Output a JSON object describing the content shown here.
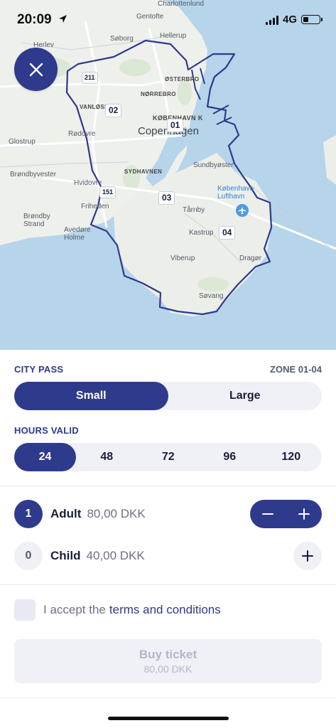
{
  "status_bar": {
    "time": "20:09",
    "network": "4G"
  },
  "map": {
    "zones": [
      "01",
      "02",
      "03",
      "04"
    ],
    "places": [
      "Charlottenlund",
      "Gentofte",
      "Herlev",
      "Søborg",
      "Hellerup",
      "ØSTERBRO",
      "NØRREBRO",
      "VANLØSE",
      "KØBENHAVN K",
      "Copenhagen",
      "Glostrup",
      "Rødovre",
      "Brøndbyvester",
      "SYDHAVNEN",
      "Hvidovre",
      "Sundbyøster",
      "København Lufthavn",
      "Friheden",
      "Tårnby",
      "Brøndby Strand",
      "Avedøre Holme",
      "Kastrup",
      "Dragør",
      "Viberup",
      "Søvang"
    ],
    "roads": [
      "211",
      "151"
    ]
  },
  "panel": {
    "pass_label": "CITY PASS",
    "zone_label": "ZONE 01-04",
    "size_options": [
      "Small",
      "Large"
    ],
    "selected_size": "Small",
    "hours_label": "HOURS VALID",
    "hours_options": [
      "24",
      "48",
      "72",
      "96",
      "120"
    ],
    "selected_hours": "24",
    "tickets": [
      {
        "count": "1",
        "name": "Adult",
        "price": "80,00 DKK"
      },
      {
        "count": "0",
        "name": "Child",
        "price": "40,00 DKK"
      }
    ],
    "terms_prefix": "I accept the",
    "terms_link": "terms and conditions",
    "buy_label": "Buy ticket",
    "buy_total": "80,00 DKK"
  },
  "colors": {
    "accent": "#2e3a8c",
    "water": "#b6d4ea",
    "land": "#eef0ec",
    "panel_bg": "#f0f1f7"
  },
  "icons": [
    "location-arrow-icon",
    "signal-icon",
    "battery-icon",
    "close-icon",
    "airport-icon",
    "minus-icon",
    "plus-icon"
  ]
}
